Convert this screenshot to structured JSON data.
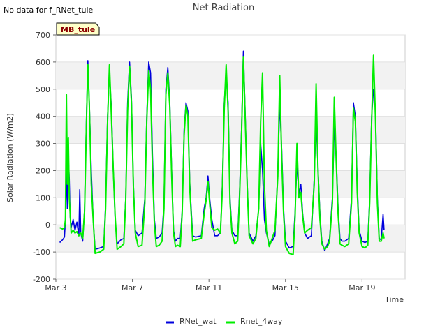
{
  "header": {
    "nodata_note": "No data for f_RNet_tule",
    "site_badge": "MB_tule"
  },
  "chart_data": {
    "type": "line",
    "title": "Net Radiation",
    "xlabel": "Time",
    "ylabel": "Solar Radiation (W/m2)",
    "ylim": [
      -200,
      700
    ],
    "xlim": [
      3.0,
      21.25
    ],
    "x_unit": "day of March",
    "y_ticks": [
      -200,
      -100,
      0,
      100,
      200,
      300,
      400,
      500,
      600,
      700
    ],
    "x_ticks": [
      {
        "day": 3,
        "label": "Mar 3"
      },
      {
        "day": 7,
        "label": "Mar 7"
      },
      {
        "day": 11,
        "label": "Mar 11"
      },
      {
        "day": 15,
        "label": "Mar 15"
      },
      {
        "day": 19,
        "label": "Mar 19"
      }
    ],
    "grid": true,
    "legend_position": "bottom",
    "series": [
      {
        "name": "RNet_wat",
        "color": "#0000dd",
        "points": [
          [
            3.2,
            -65
          ],
          [
            3.35,
            -55
          ],
          [
            3.45,
            -45
          ],
          [
            3.5,
            20
          ],
          [
            3.55,
            200
          ],
          [
            3.6,
            60
          ],
          [
            3.65,
            250
          ],
          [
            3.7,
            170
          ],
          [
            3.75,
            30
          ],
          [
            3.8,
            -10
          ],
          [
            3.9,
            20
          ],
          [
            4.0,
            -20
          ],
          [
            4.1,
            10
          ],
          [
            4.2,
            -40
          ],
          [
            4.25,
            130
          ],
          [
            4.3,
            -30
          ],
          [
            4.4,
            -60
          ],
          [
            4.5,
            60
          ],
          [
            4.6,
            400
          ],
          [
            4.67,
            605
          ],
          [
            4.75,
            450
          ],
          [
            4.85,
            200
          ],
          [
            4.95,
            20
          ],
          [
            5.05,
            -90
          ],
          [
            5.3,
            -85
          ],
          [
            5.5,
            -80
          ],
          [
            5.6,
            80
          ],
          [
            5.7,
            400
          ],
          [
            5.8,
            560
          ],
          [
            5.9,
            430
          ],
          [
            6.0,
            200
          ],
          [
            6.1,
            20
          ],
          [
            6.2,
            -70
          ],
          [
            6.4,
            -55
          ],
          [
            6.55,
            -50
          ],
          [
            6.65,
            100
          ],
          [
            6.75,
            450
          ],
          [
            6.85,
            600
          ],
          [
            6.95,
            470
          ],
          [
            7.05,
            150
          ],
          [
            7.15,
            -20
          ],
          [
            7.3,
            -40
          ],
          [
            7.5,
            -30
          ],
          [
            7.65,
            100
          ],
          [
            7.75,
            400
          ],
          [
            7.85,
            600
          ],
          [
            7.95,
            560
          ],
          [
            8.05,
            250
          ],
          [
            8.15,
            20
          ],
          [
            8.25,
            -50
          ],
          [
            8.4,
            -45
          ],
          [
            8.55,
            -30
          ],
          [
            8.65,
            80
          ],
          [
            8.75,
            500
          ],
          [
            8.85,
            580
          ],
          [
            8.95,
            460
          ],
          [
            9.05,
            200
          ],
          [
            9.15,
            -20
          ],
          [
            9.25,
            -60
          ],
          [
            9.35,
            -50
          ],
          [
            9.5,
            -50
          ],
          [
            9.6,
            50
          ],
          [
            9.7,
            350
          ],
          [
            9.8,
            450
          ],
          [
            9.9,
            420
          ],
          [
            10.0,
            150
          ],
          [
            10.15,
            -40
          ],
          [
            10.3,
            -45
          ],
          [
            10.6,
            -40
          ],
          [
            10.75,
            60
          ],
          [
            10.85,
            100
          ],
          [
            10.95,
            180
          ],
          [
            11.05,
            90
          ],
          [
            11.15,
            20
          ],
          [
            11.3,
            -40
          ],
          [
            11.45,
            -40
          ],
          [
            11.6,
            -30
          ],
          [
            11.7,
            150
          ],
          [
            11.8,
            450
          ],
          [
            11.9,
            550
          ],
          [
            12.0,
            450
          ],
          [
            12.1,
            100
          ],
          [
            12.2,
            -20
          ],
          [
            12.35,
            -40
          ],
          [
            12.5,
            -40
          ],
          [
            12.6,
            120
          ],
          [
            12.7,
            350
          ],
          [
            12.8,
            640
          ],
          [
            12.9,
            400
          ],
          [
            13.0,
            150
          ],
          [
            13.1,
            -30
          ],
          [
            13.3,
            -60
          ],
          [
            13.45,
            -40
          ],
          [
            13.6,
            60
          ],
          [
            13.7,
            300
          ],
          [
            13.8,
            200
          ],
          [
            13.9,
            20
          ],
          [
            14.0,
            -30
          ],
          [
            14.15,
            -70
          ],
          [
            14.3,
            -60
          ],
          [
            14.45,
            -40
          ],
          [
            14.6,
            200
          ],
          [
            14.7,
            450
          ],
          [
            14.8,
            280
          ],
          [
            14.9,
            60
          ],
          [
            15.0,
            -60
          ],
          [
            15.2,
            -85
          ],
          [
            15.4,
            -80
          ],
          [
            15.5,
            50
          ],
          [
            15.6,
            230
          ],
          [
            15.7,
            110
          ],
          [
            15.8,
            150
          ],
          [
            15.9,
            40
          ],
          [
            16.0,
            -30
          ],
          [
            16.15,
            -50
          ],
          [
            16.35,
            -40
          ],
          [
            16.5,
            170
          ],
          [
            16.6,
            400
          ],
          [
            16.7,
            210
          ],
          [
            16.8,
            40
          ],
          [
            16.9,
            -60
          ],
          [
            17.05,
            -95
          ],
          [
            17.2,
            -70
          ],
          [
            17.3,
            -50
          ],
          [
            17.45,
            100
          ],
          [
            17.55,
            360
          ],
          [
            17.65,
            250
          ],
          [
            17.75,
            60
          ],
          [
            17.85,
            -50
          ],
          [
            17.95,
            -60
          ],
          [
            18.1,
            -60
          ],
          [
            18.3,
            -50
          ],
          [
            18.45,
            100
          ],
          [
            18.55,
            450
          ],
          [
            18.65,
            400
          ],
          [
            18.75,
            150
          ],
          [
            18.85,
            -20
          ],
          [
            19.0,
            -60
          ],
          [
            19.15,
            -65
          ],
          [
            19.3,
            -60
          ],
          [
            19.4,
            100
          ],
          [
            19.5,
            400
          ],
          [
            19.6,
            500
          ],
          [
            19.7,
            430
          ],
          [
            19.8,
            100
          ],
          [
            19.9,
            -50
          ],
          [
            20.0,
            -55
          ],
          [
            20.1,
            40
          ],
          [
            20.15,
            -20
          ]
        ]
      },
      {
        "name": "Rnet_4way",
        "color": "#00ee00",
        "points": [
          [
            3.2,
            -10
          ],
          [
            3.35,
            -15
          ],
          [
            3.45,
            -10
          ],
          [
            3.5,
            20
          ],
          [
            3.55,
            480
          ],
          [
            3.6,
            150
          ],
          [
            3.65,
            320
          ],
          [
            3.7,
            100
          ],
          [
            3.75,
            40
          ],
          [
            3.8,
            -30
          ],
          [
            3.9,
            -20
          ],
          [
            4.0,
            -30
          ],
          [
            4.1,
            -25
          ],
          [
            4.2,
            -40
          ],
          [
            4.3,
            -30
          ],
          [
            4.4,
            -50
          ],
          [
            4.5,
            50
          ],
          [
            4.6,
            380
          ],
          [
            4.67,
            590
          ],
          [
            4.75,
            440
          ],
          [
            4.85,
            150
          ],
          [
            4.95,
            20
          ],
          [
            5.05,
            -105
          ],
          [
            5.3,
            -100
          ],
          [
            5.5,
            -90
          ],
          [
            5.6,
            60
          ],
          [
            5.7,
            380
          ],
          [
            5.8,
            590
          ],
          [
            5.9,
            400
          ],
          [
            6.0,
            200
          ],
          [
            6.1,
            30
          ],
          [
            6.2,
            -90
          ],
          [
            6.4,
            -80
          ],
          [
            6.55,
            -70
          ],
          [
            6.65,
            90
          ],
          [
            6.75,
            420
          ],
          [
            6.85,
            585
          ],
          [
            6.95,
            450
          ],
          [
            7.05,
            140
          ],
          [
            7.15,
            -30
          ],
          [
            7.3,
            -80
          ],
          [
            7.5,
            -75
          ],
          [
            7.65,
            80
          ],
          [
            7.75,
            380
          ],
          [
            7.85,
            570
          ],
          [
            7.95,
            500
          ],
          [
            8.05,
            200
          ],
          [
            8.15,
            0
          ],
          [
            8.25,
            -80
          ],
          [
            8.4,
            -75
          ],
          [
            8.55,
            -60
          ],
          [
            8.65,
            60
          ],
          [
            8.75,
            480
          ],
          [
            8.85,
            560
          ],
          [
            8.95,
            440
          ],
          [
            9.05,
            180
          ],
          [
            9.15,
            -30
          ],
          [
            9.25,
            -80
          ],
          [
            9.35,
            -75
          ],
          [
            9.5,
            -80
          ],
          [
            9.6,
            40
          ],
          [
            9.7,
            330
          ],
          [
            9.8,
            440
          ],
          [
            9.9,
            400
          ],
          [
            10.0,
            130
          ],
          [
            10.15,
            -60
          ],
          [
            10.3,
            -55
          ],
          [
            10.6,
            -50
          ],
          [
            10.75,
            40
          ],
          [
            10.85,
            90
          ],
          [
            10.95,
            160
          ],
          [
            11.05,
            70
          ],
          [
            11.15,
            -10
          ],
          [
            11.3,
            -20
          ],
          [
            11.45,
            -15
          ],
          [
            11.6,
            -30
          ],
          [
            11.7,
            130
          ],
          [
            11.8,
            430
          ],
          [
            11.9,
            590
          ],
          [
            12.0,
            420
          ],
          [
            12.1,
            80
          ],
          [
            12.2,
            -30
          ],
          [
            12.35,
            -70
          ],
          [
            12.5,
            -60
          ],
          [
            12.6,
            100
          ],
          [
            12.7,
            330
          ],
          [
            12.8,
            620
          ],
          [
            12.9,
            380
          ],
          [
            13.0,
            140
          ],
          [
            13.1,
            -40
          ],
          [
            13.3,
            -70
          ],
          [
            13.45,
            -50
          ],
          [
            13.6,
            60
          ],
          [
            13.7,
            380
          ],
          [
            13.8,
            560
          ],
          [
            13.9,
            150
          ],
          [
            14.0,
            -20
          ],
          [
            14.15,
            -80
          ],
          [
            14.3,
            -50
          ],
          [
            14.45,
            -20
          ],
          [
            14.6,
            180
          ],
          [
            14.7,
            550
          ],
          [
            14.8,
            250
          ],
          [
            14.9,
            40
          ],
          [
            15.0,
            -80
          ],
          [
            15.2,
            -105
          ],
          [
            15.4,
            -110
          ],
          [
            15.5,
            30
          ],
          [
            15.6,
            300
          ],
          [
            15.7,
            100
          ],
          [
            15.8,
            120
          ],
          [
            15.9,
            30
          ],
          [
            16.0,
            -30
          ],
          [
            16.15,
            -20
          ],
          [
            16.35,
            -10
          ],
          [
            16.5,
            150
          ],
          [
            16.6,
            520
          ],
          [
            16.7,
            200
          ],
          [
            16.8,
            20
          ],
          [
            16.9,
            -70
          ],
          [
            17.05,
            -90
          ],
          [
            17.2,
            -80
          ],
          [
            17.3,
            -60
          ],
          [
            17.45,
            80
          ],
          [
            17.55,
            470
          ],
          [
            17.65,
            230
          ],
          [
            17.75,
            40
          ],
          [
            17.85,
            -70
          ],
          [
            17.95,
            -75
          ],
          [
            18.1,
            -80
          ],
          [
            18.3,
            -70
          ],
          [
            18.45,
            80
          ],
          [
            18.55,
            430
          ],
          [
            18.65,
            380
          ],
          [
            18.75,
            120
          ],
          [
            18.85,
            -30
          ],
          [
            19.0,
            -80
          ],
          [
            19.15,
            -85
          ],
          [
            19.3,
            -75
          ],
          [
            19.4,
            80
          ],
          [
            19.5,
            380
          ],
          [
            19.6,
            625
          ],
          [
            19.7,
            400
          ],
          [
            19.8,
            80
          ],
          [
            19.9,
            -60
          ],
          [
            20.0,
            -60
          ],
          [
            20.1,
            -30
          ],
          [
            20.15,
            -50
          ]
        ]
      }
    ]
  }
}
